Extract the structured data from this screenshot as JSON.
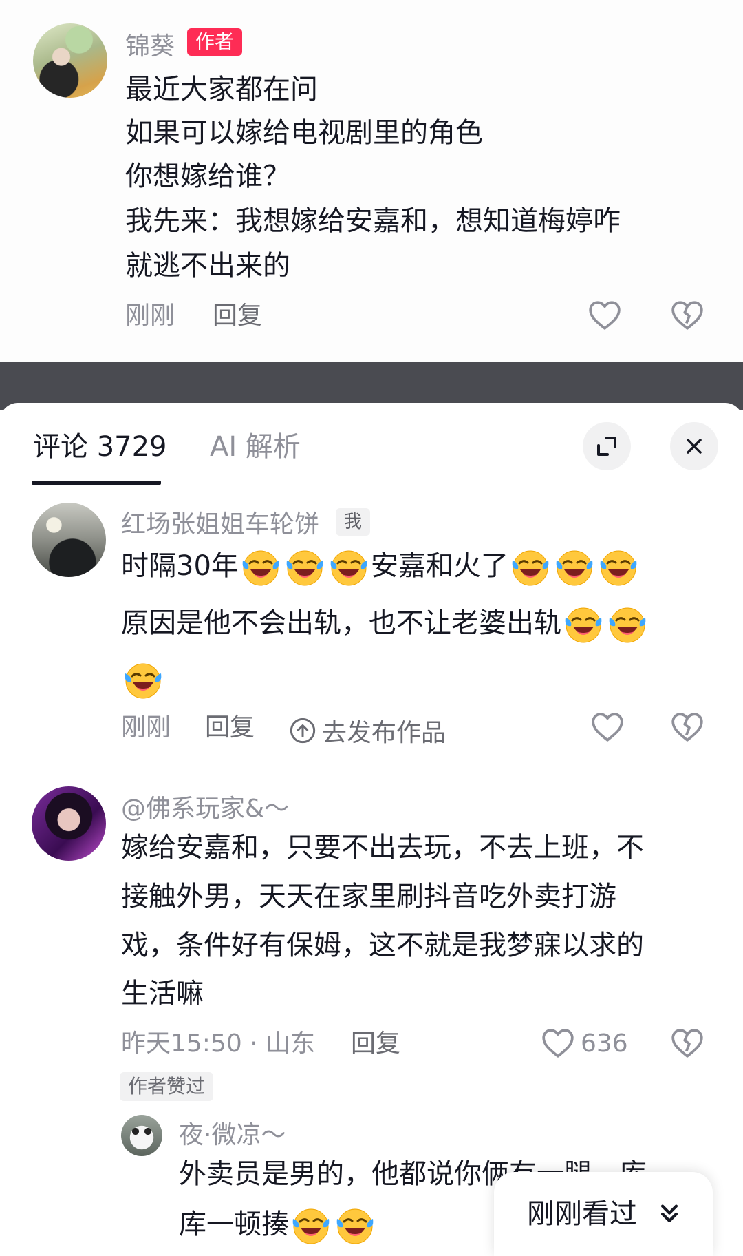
{
  "author_comment": {
    "username": "锦葵",
    "author_badge": "作者",
    "lines": [
      "最近大家都在问",
      "如果可以嫁给电视剧里的角色",
      "你想嫁给谁？",
      "我先来：我想嫁给安嘉和，想知道梅婷咋",
      "就逃不出来的"
    ],
    "time": "刚刚",
    "reply_label": "回复"
  },
  "sheet": {
    "tab_comments": "评论 3729",
    "tab_ai": "AI 解析"
  },
  "comments": [
    {
      "username": "红场张姐姐车轮饼",
      "me_badge": "我",
      "line1_a": "时隔30年",
      "line1_b": "安嘉和火了",
      "line2": "原因是他不会出轨，也不让老婆出轨",
      "time": "刚刚",
      "reply_label": "回复",
      "publish_label": "去发布作品"
    },
    {
      "username": "@佛系玩家&～",
      "lines": [
        "嫁给安嘉和，只要不出去玩，不去上班，不",
        "接触外男，天天在家里刷抖音吃外卖打游",
        "戏，条件好有保姆，这不就是我梦寐以求的",
        "生活嘛"
      ],
      "time_location": "昨天15:50 · 山东",
      "reply_label": "回复",
      "like_count": "636",
      "author_liked": "作者赞过"
    }
  ],
  "reply": {
    "username": "夜·微凉～",
    "line1": "外卖员是男的，他都说你俩有一腿，库",
    "line2": "库一顿揍"
  },
  "recent_pill": {
    "label": "刚刚看过"
  },
  "icons": {
    "like": "heart-outline-icon",
    "dislike": "broken-heart-icon",
    "expand": "expand-icon",
    "close": "close-icon",
    "publish": "upload-arrow-icon",
    "emoji": "laugh-cry-emoji-icon",
    "chevron": "double-chevron-down-icon"
  },
  "colors": {
    "accent": "#fe2c55",
    "text": "#161823",
    "muted": "#8f9099"
  }
}
